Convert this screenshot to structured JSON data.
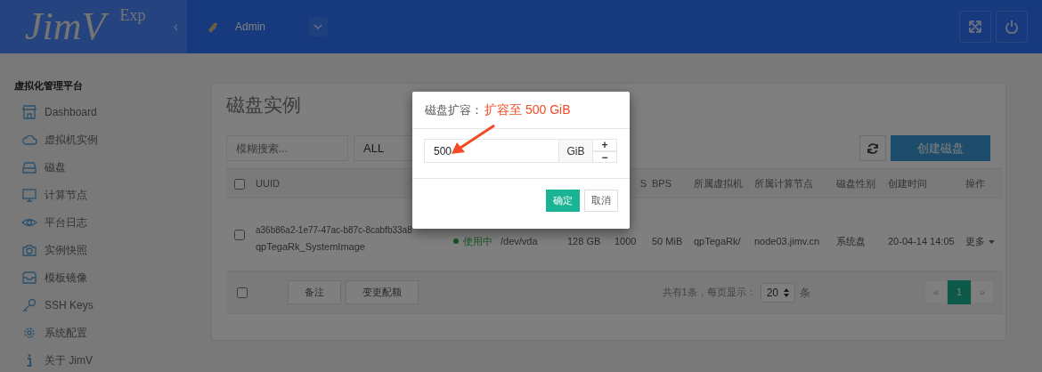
{
  "header": {
    "logo": "JimV",
    "logo_sup": "Exp",
    "collapse": "‹",
    "user": "Admin"
  },
  "sidebar": {
    "title": "虚拟化管理平台",
    "items": [
      {
        "label": "Dashboard"
      },
      {
        "label": "虚拟机实例"
      },
      {
        "label": "磁盘"
      },
      {
        "label": "计算节点"
      },
      {
        "label": "平台日志"
      },
      {
        "label": "实例快照"
      },
      {
        "label": "模板镜像"
      },
      {
        "label": "SSH Keys"
      },
      {
        "label": "系统配置"
      },
      {
        "label": "关于 JimV"
      }
    ]
  },
  "page": {
    "title": "磁盘实例",
    "search": {
      "placeholder": "模糊搜索..."
    },
    "filter": "ALL",
    "create_button": "创建磁盘"
  },
  "table": {
    "select_all": {
      "checked": false
    },
    "columns": [
      "UUID",
      "",
      "",
      "",
      "S",
      "BPS",
      "所属虚拟机",
      "所属计算节点",
      "磁盘性别",
      "创建时间",
      "操作"
    ],
    "rows": [
      {
        "checked": false,
        "uuid": "a36b86a2-1e77-47ac-b87c-8cabfb33a8",
        "name": "qpTegaRk_SystemImage",
        "status": "使用中",
        "device": "/dev/vda",
        "size": "128 GB",
        "iops": "1000",
        "bps": "50 MiB",
        "vm": "qpTegaRk/",
        "node": "node03.jimv.cn",
        "disk_type": "系统盘",
        "created": "20-04-14 14:05",
        "action": "更多"
      }
    ]
  },
  "footer": {
    "select_all": {
      "checked": false
    },
    "buttons": [
      "备注",
      "变更配额"
    ],
    "summary": "共有1条，每页显示：",
    "per_page": "20",
    "per_page_unit": "条",
    "prev": "«",
    "pages": [
      {
        "label": "1",
        "selected": true
      }
    ],
    "next": "»"
  },
  "modal": {
    "title": "磁盘扩容：",
    "note": "扩容至 500 GiB",
    "value": "500",
    "unit": "GiB",
    "increment": "+",
    "decrement": "−",
    "confirm": "确定",
    "cancel": "取消"
  }
}
